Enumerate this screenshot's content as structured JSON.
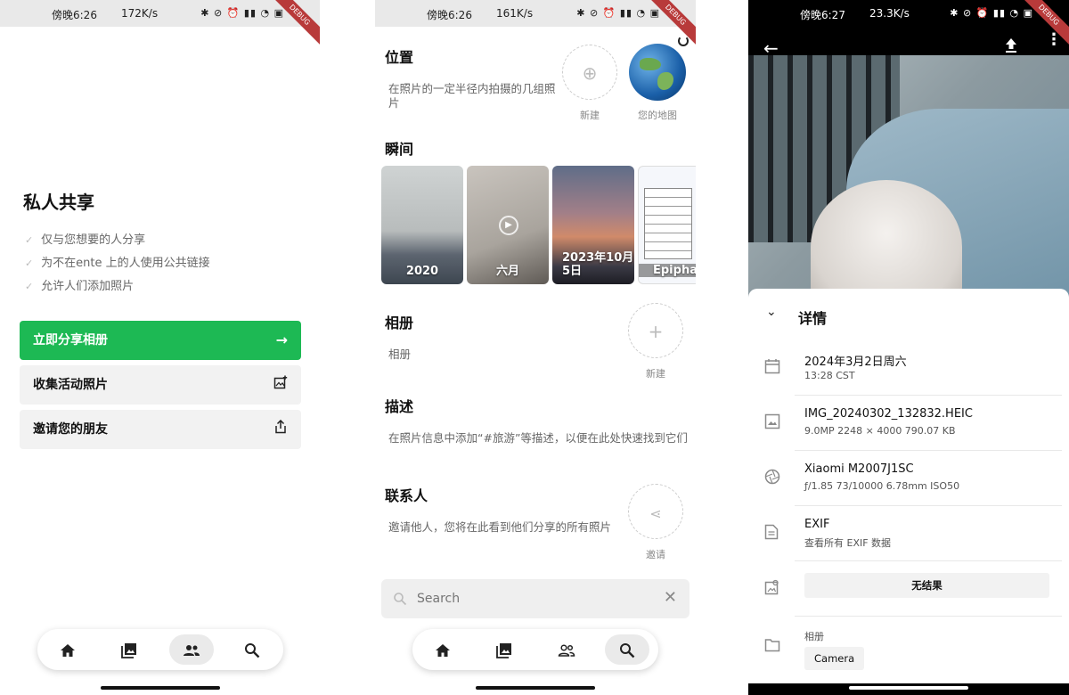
{
  "status": {
    "s1": {
      "time": "傍晚6:26",
      "speed": "172K/s",
      "icons": "✱ ⊘ ⏰ ▮▮ ◔ ▣"
    },
    "s2": {
      "time": "傍晚6:26",
      "speed": "161K/s",
      "icons": "✱ ⊘ ⏰ ▮▮ ◔ ▣"
    },
    "s3": {
      "time": "傍晚6:27",
      "speed": "23.3K/s",
      "icons": "✱ ⊘ ⏰ ▮▮ ◔ ▣"
    },
    "debug": "DEBUG"
  },
  "share": {
    "title": "私人共享",
    "features": [
      "仅与您想要的人分享",
      "为不在ente 上的人使用公共链接",
      "允许人们添加照片"
    ],
    "share_album_button": "立即分享相册",
    "collect_button": "收集活动照片",
    "invite_button": "邀请您的朋友"
  },
  "search_page": {
    "locations": {
      "title": "位置",
      "desc": "在照片的一定半径内拍摄的几组照片",
      "new_label": "新建",
      "map_label": "您的地图"
    },
    "moments": {
      "title": "瞬间",
      "items": [
        "2020",
        "六月",
        "2023年10月5日",
        "Epiphan"
      ]
    },
    "albums": {
      "title": "相册",
      "desc": "相册",
      "new_label": "新建"
    },
    "description": {
      "title": "描述",
      "desc": "在照片信息中添加“#旅游”等描述，以便在此处快速找到它们"
    },
    "contacts": {
      "title": "联系人",
      "desc": "邀请他人，您将在此看到他们分享的所有照片",
      "invite_label": "邀请"
    },
    "search_placeholder": "Search"
  },
  "details": {
    "title": "详情",
    "date": {
      "main": "2024年3月2日周六",
      "sub": "13:28  CST"
    },
    "file": {
      "main": "IMG_20240302_132832.HEIC",
      "sub": "9.0MP   2248 × 4000   790.07 KB"
    },
    "camera": {
      "main": "Xiaomi M2007J1SC",
      "sub": "ƒ/1.85   73/10000   6.78mm   ISO50"
    },
    "exif": {
      "main": "EXIF",
      "sub": "查看所有 EXIF 数据"
    },
    "faces_button": "无结果",
    "albums_label": "相册",
    "album_chip": "Camera"
  },
  "colors": {
    "accent": "#1db954"
  }
}
